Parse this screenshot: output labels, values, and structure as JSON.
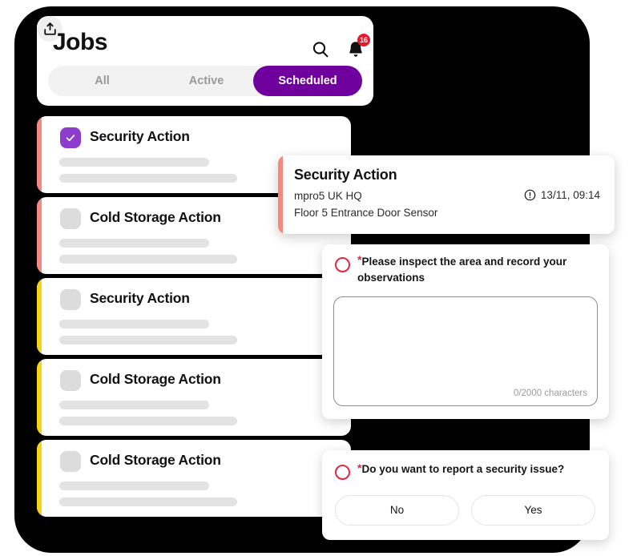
{
  "header": {
    "title": "Jobs",
    "search_icon": "search-icon",
    "bell_icon": "bell-icon",
    "upload_icon": "upload-icon",
    "notification_count": "16",
    "badge_color": "#e01b2e"
  },
  "tabs": [
    {
      "label": "All",
      "active": false
    },
    {
      "label": "Active",
      "active": false
    },
    {
      "label": "Scheduled",
      "active": true
    }
  ],
  "tab_active_color": "#6f009e",
  "jobs": [
    {
      "title": "Security Action",
      "checked": true,
      "accent": "#f5897f"
    },
    {
      "title": "Cold Storage Action",
      "checked": false,
      "accent": "#f5897f"
    },
    {
      "title": "Security Action",
      "checked": false,
      "accent": "#f5d418"
    },
    {
      "title": "Cold Storage Action",
      "checked": false,
      "accent": "#f5d418"
    },
    {
      "title": "Cold Storage Action",
      "checked": false,
      "accent": "#f5d418"
    }
  ],
  "detail": {
    "title": "Security Action",
    "site": "mpro5 UK HQ",
    "location": "Floor 5 Entrance Door Sensor",
    "time": "13/11, 09:14",
    "time_icon": "alert-circle-icon",
    "accent": "#f5897f"
  },
  "observation_question": {
    "required_marker": "*",
    "label": "Please inspect the area and record your observations",
    "textarea_value": "",
    "char_counter": "0/2000 characters",
    "radio_color": "#e8253c"
  },
  "security_issue_question": {
    "required_marker": "*",
    "label": "Do you want to report a security issue?",
    "options": [
      {
        "label": "No"
      },
      {
        "label": "Yes"
      }
    ],
    "radio_color": "#e8253c"
  }
}
